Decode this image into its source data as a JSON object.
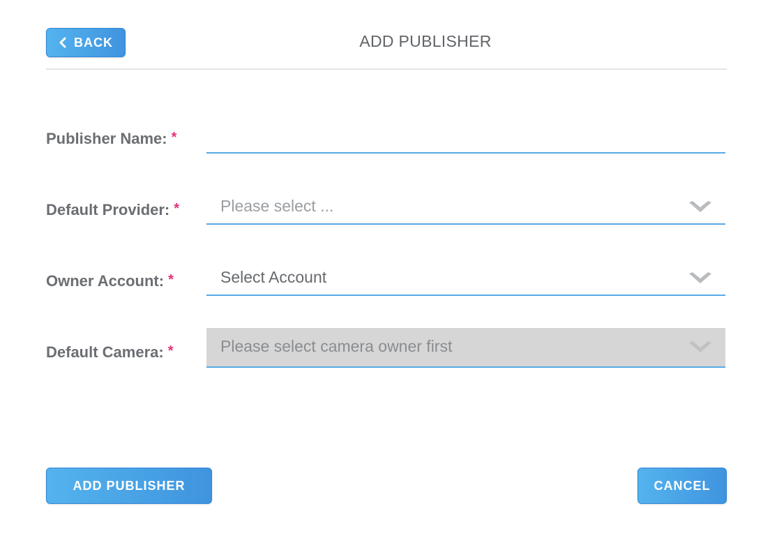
{
  "header": {
    "back_label": "BACK",
    "title": "ADD PUBLISHER"
  },
  "form": {
    "publisher_name": {
      "label": "Publisher Name:",
      "required": "*",
      "value": ""
    },
    "default_provider": {
      "label": "Default Provider:",
      "required": "*",
      "placeholder": "Please select ..."
    },
    "owner_account": {
      "label": "Owner Account:",
      "required": "*",
      "value": "Select Account"
    },
    "default_camera": {
      "label": "Default Camera:",
      "required": "*",
      "placeholder": "Please select camera owner first"
    }
  },
  "footer": {
    "add_label": "ADD PUBLISHER",
    "cancel_label": "CANCEL"
  },
  "colors": {
    "accent": "#4ba4e8",
    "required": "#e4317a",
    "disabled_bg": "#d6d6d6"
  },
  "icons": {
    "back": "chevron-left-icon",
    "dropdown": "chevron-down-icon"
  }
}
